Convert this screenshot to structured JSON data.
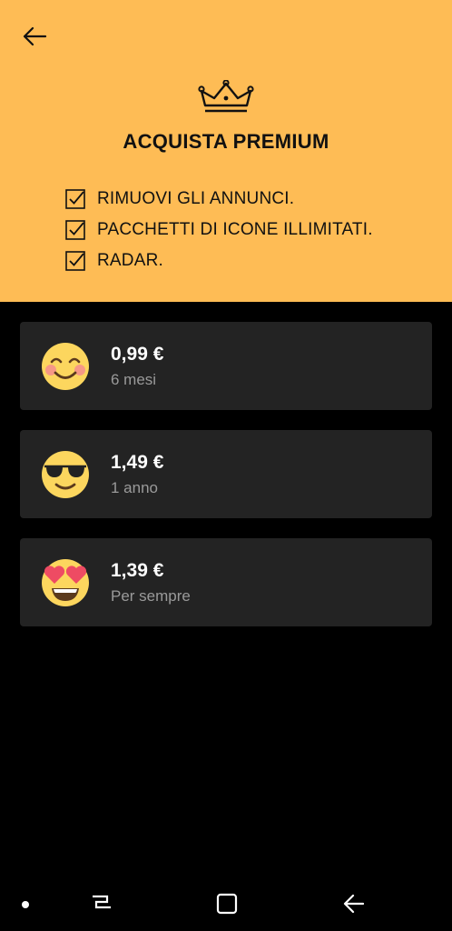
{
  "header": {
    "title": "ACQUISTA PREMIUM",
    "background_color": "#FEBC55",
    "back_icon": "arrow-left-icon",
    "crown_icon": "crown-icon"
  },
  "features": [
    {
      "label": "RIMUOVI GLI ANNUNCI.",
      "icon": "checkbox-checked-icon"
    },
    {
      "label": "PACCHETTI DI ICONE ILLIMITATI.",
      "icon": "checkbox-checked-icon"
    },
    {
      "label": "RADAR.",
      "icon": "checkbox-checked-icon"
    }
  ],
  "plans": [
    {
      "price": "0,99 €",
      "duration": "6 mesi",
      "icon": "smiling-blush-emoji-icon"
    },
    {
      "price": "1,49 €",
      "duration": "1 anno",
      "icon": "sunglasses-emoji-icon"
    },
    {
      "price": "1,39 €",
      "duration": "Per sempre",
      "icon": "heart-eyes-emoji-icon"
    }
  ],
  "navbar": {
    "recents_icon": "recents-icon",
    "home_icon": "home-icon",
    "back_icon": "back-arrow-icon"
  },
  "colors": {
    "accent": "#FEBC55",
    "card": "#232323",
    "background": "#000000",
    "emoji_yellow": "#FCD65E"
  }
}
